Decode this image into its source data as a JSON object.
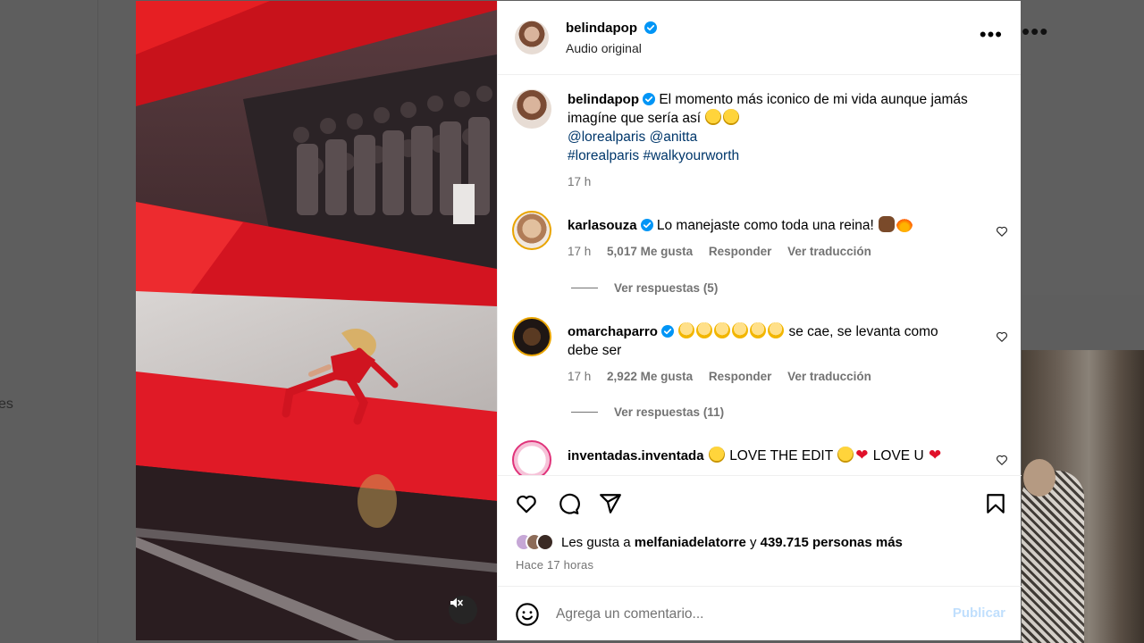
{
  "background": {
    "left_partial_text": "es"
  },
  "post": {
    "author": "belindapop",
    "author_subtitle": "Audio original",
    "verified_color": "#0095f6",
    "caption": {
      "username": "belindapop",
      "text_line1": "El momento más iconico de mi vida aunque jamás",
      "text_line2": "imagíne que sería así",
      "mentions": [
        "@lorealparis",
        "@anitta"
      ],
      "hashtags": [
        "#lorealparis",
        "#walkyourworth"
      ],
      "time": "17 h"
    },
    "comments": [
      {
        "username": "karlasouza",
        "text": "Lo manejaste como toda una reina!",
        "time": "17 h",
        "likes": "5,017 Me gusta",
        "reply": "Responder",
        "translate": "Ver traducción",
        "view_replies": "Ver respuestas (5)"
      },
      {
        "username": "omarchaparro",
        "text_after_emoji": "se cae, se levanta como",
        "text_line2": "debe ser",
        "time": "17 h",
        "likes": "2,922 Me gusta",
        "reply": "Responder",
        "translate": "Ver traducción",
        "view_replies": "Ver respuestas (11)"
      },
      {
        "username": "inventadas.inventada",
        "text_part1": "LOVE THE EDIT",
        "text_part2": "LOVE U"
      }
    ],
    "liked_by_prefix": "Les gusta a",
    "liked_by_user": "melfaniadelatorre",
    "liked_by_connector": "y",
    "liked_by_others": "439.715 personas más",
    "time_ago": "Hace 17 horas",
    "comment_placeholder": "Agrega un comentario...",
    "publish_label": "Publicar",
    "publish_color": "#c0dffd"
  },
  "icons": {
    "more": "more-options-icon",
    "like": "heart-icon",
    "comment": "comment-icon",
    "share": "send-icon",
    "save": "bookmark-icon",
    "emoji": "emoji-icon",
    "mute": "muted-speaker-icon"
  }
}
